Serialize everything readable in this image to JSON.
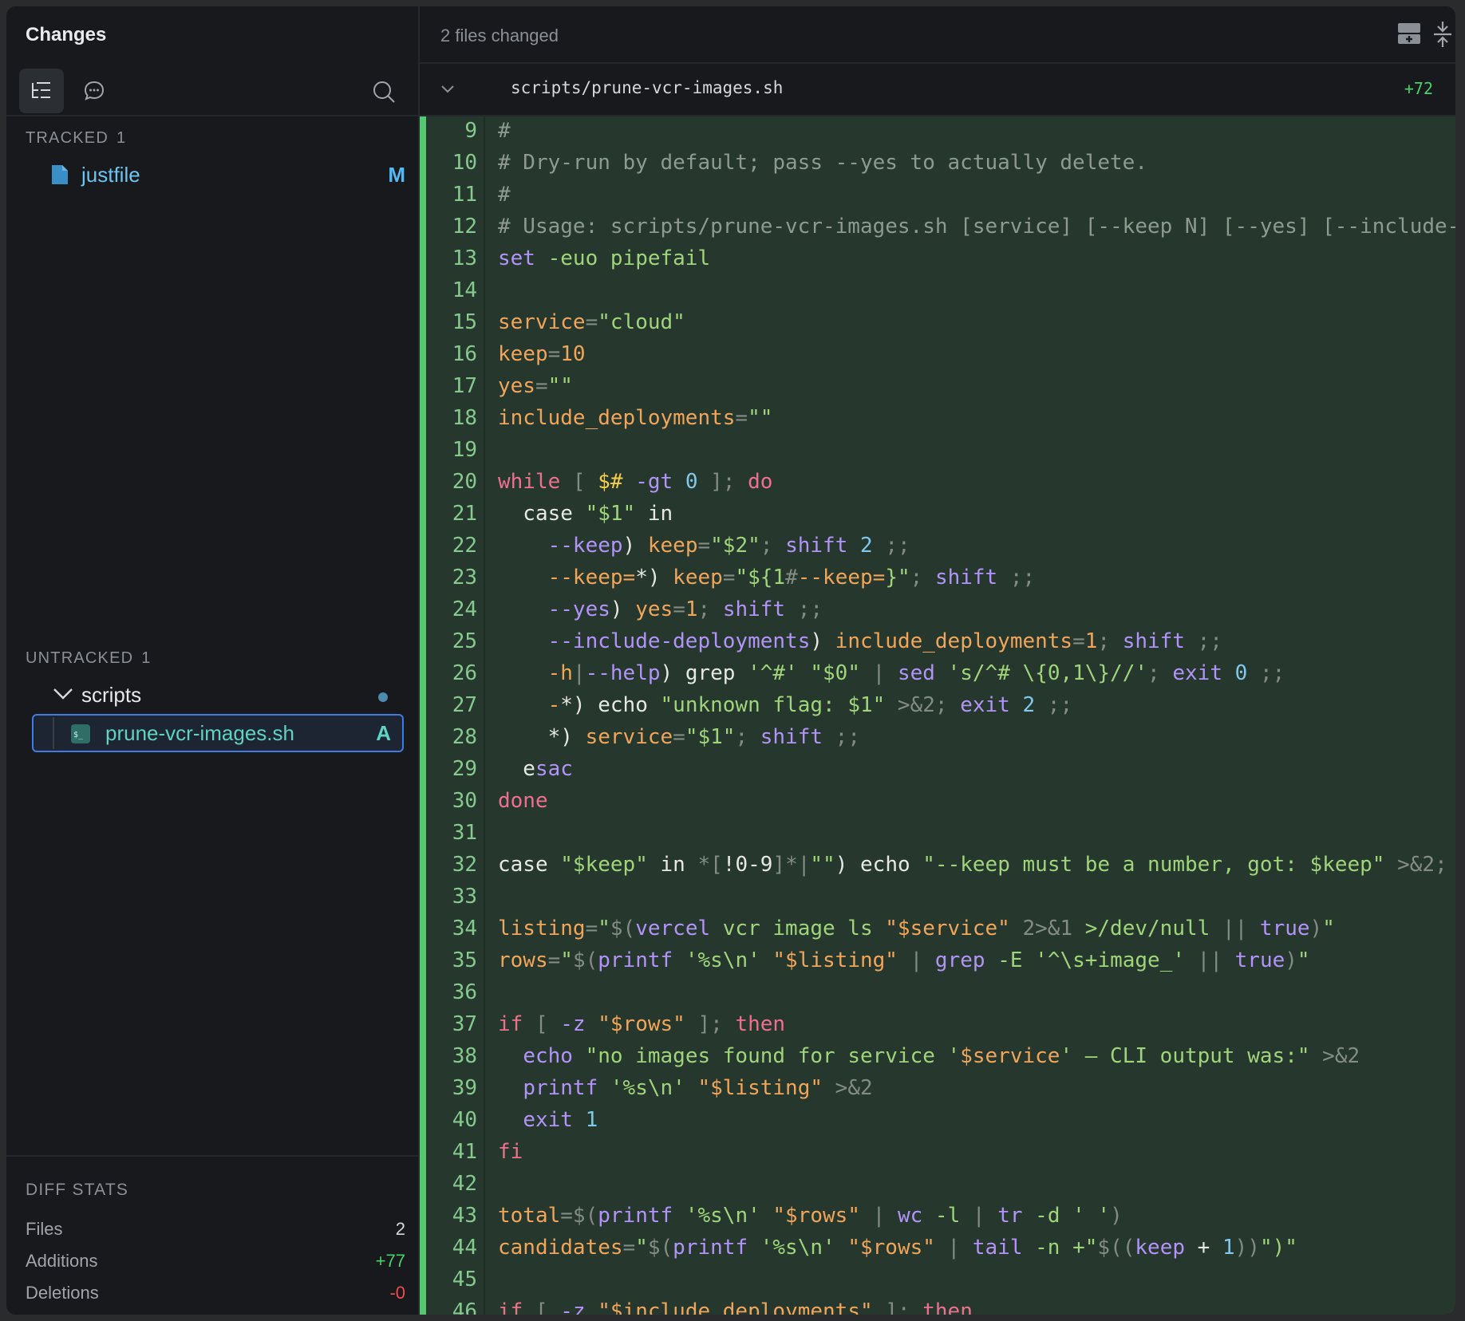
{
  "sidebar": {
    "title": "Changes",
    "tracked": {
      "label": "TRACKED",
      "count": "1",
      "file": "justfile",
      "status": "M"
    },
    "untracked": {
      "label": "UNTRACKED",
      "count": "1",
      "folder": "scripts",
      "file": "prune-vcr-images.sh",
      "status": "A"
    },
    "stats": {
      "label": "DIFF STATS",
      "files_label": "Files",
      "files_value": "2",
      "additions_label": "Additions",
      "additions_value": "+77",
      "deletions_label": "Deletions",
      "deletions_value": "-0"
    }
  },
  "header": {
    "files_changed": "2 files changed"
  },
  "file": {
    "path": "scripts/prune-vcr-images.sh",
    "additions": "+72"
  },
  "colors": {
    "accent": "#3f7be0",
    "added": "#56c86f",
    "code_bg": "#26382d"
  },
  "code_lines": [
    {
      "n": "9",
      "tokens": [
        [
          "cm",
          "#"
        ]
      ]
    },
    {
      "n": "10",
      "tokens": [
        [
          "cm",
          "# Dry-run by default; pass --yes to actually delete."
        ]
      ]
    },
    {
      "n": "11",
      "tokens": [
        [
          "cm",
          "#"
        ]
      ]
    },
    {
      "n": "12",
      "tokens": [
        [
          "cm",
          "# Usage: scripts/prune-vcr-images.sh [service] [--keep N] [--yes] [--include-"
        ]
      ]
    },
    {
      "n": "13",
      "tokens": [
        [
          "bi",
          "set"
        ],
        [
          "pl",
          " "
        ],
        [
          "st",
          "-euo pipefail"
        ]
      ]
    },
    {
      "n": "14",
      "tokens": []
    },
    {
      "n": "15",
      "tokens": [
        [
          "va",
          "service"
        ],
        [
          "op",
          "="
        ],
        [
          "st",
          "\"cloud\""
        ]
      ]
    },
    {
      "n": "16",
      "tokens": [
        [
          "va",
          "keep"
        ],
        [
          "op",
          "="
        ],
        [
          "va",
          "10"
        ]
      ]
    },
    {
      "n": "17",
      "tokens": [
        [
          "va",
          "yes"
        ],
        [
          "op",
          "="
        ],
        [
          "st",
          "\"\""
        ]
      ]
    },
    {
      "n": "18",
      "tokens": [
        [
          "va",
          "include_deployments"
        ],
        [
          "op",
          "="
        ],
        [
          "st",
          "\"\""
        ]
      ]
    },
    {
      "n": "19",
      "tokens": []
    },
    {
      "n": "20",
      "tokens": [
        [
          "kw",
          "while"
        ],
        [
          "op",
          " [ "
        ],
        [
          "sy",
          "$#"
        ],
        [
          "bi",
          " -gt "
        ],
        [
          "nu",
          "0"
        ],
        [
          "op",
          " ]; "
        ],
        [
          "kw",
          "do"
        ]
      ]
    },
    {
      "n": "21",
      "tokens": [
        [
          "pl",
          "  case "
        ],
        [
          "st",
          "\"$1\""
        ],
        [
          "pl",
          " in"
        ]
      ]
    },
    {
      "n": "22",
      "tokens": [
        [
          "pl",
          "    "
        ],
        [
          "bi",
          "--keep"
        ],
        [
          "pl",
          ") "
        ],
        [
          "va",
          "keep"
        ],
        [
          "op",
          "="
        ],
        [
          "st",
          "\"$2\""
        ],
        [
          "op",
          "; "
        ],
        [
          "bi",
          "shift"
        ],
        [
          "pl",
          " "
        ],
        [
          "nu",
          "2"
        ],
        [
          "op",
          " ;;"
        ]
      ]
    },
    {
      "n": "23",
      "tokens": [
        [
          "pl",
          "    "
        ],
        [
          "va",
          "--keep="
        ],
        [
          "pl",
          "*) "
        ],
        [
          "va",
          "keep"
        ],
        [
          "op",
          "="
        ],
        [
          "st",
          "\"${1"
        ],
        [
          "op",
          "#"
        ],
        [
          "va",
          "--keep="
        ],
        [
          "st",
          "}\""
        ],
        [
          "op",
          "; "
        ],
        [
          "bi",
          "shift"
        ],
        [
          "op",
          " ;;"
        ]
      ]
    },
    {
      "n": "24",
      "tokens": [
        [
          "pl",
          "    "
        ],
        [
          "bi",
          "--yes"
        ],
        [
          "pl",
          ") "
        ],
        [
          "va",
          "yes"
        ],
        [
          "op",
          "="
        ],
        [
          "va",
          "1"
        ],
        [
          "op",
          "; "
        ],
        [
          "bi",
          "shift"
        ],
        [
          "op",
          " ;;"
        ]
      ]
    },
    {
      "n": "25",
      "tokens": [
        [
          "pl",
          "    "
        ],
        [
          "bi",
          "--include-deployments"
        ],
        [
          "pl",
          ") "
        ],
        [
          "va",
          "include_deployments"
        ],
        [
          "op",
          "="
        ],
        [
          "va",
          "1"
        ],
        [
          "op",
          "; "
        ],
        [
          "bi",
          "shift"
        ],
        [
          "op",
          " ;;"
        ]
      ]
    },
    {
      "n": "26",
      "tokens": [
        [
          "pl",
          "    "
        ],
        [
          "va",
          "-h"
        ],
        [
          "op",
          "|"
        ],
        [
          "bi",
          "--help"
        ],
        [
          "pl",
          ") grep "
        ],
        [
          "st",
          "'^#'"
        ],
        [
          "pl",
          " "
        ],
        [
          "st",
          "\"$0\""
        ],
        [
          "op",
          " | "
        ],
        [
          "bi",
          "sed"
        ],
        [
          "pl",
          " "
        ],
        [
          "st",
          "'s/^# \\{0,1\\}//'"
        ],
        [
          "op",
          "; "
        ],
        [
          "bi",
          "exit"
        ],
        [
          "pl",
          " "
        ],
        [
          "nu",
          "0"
        ],
        [
          "op",
          " ;;"
        ]
      ]
    },
    {
      "n": "27",
      "tokens": [
        [
          "pl",
          "    "
        ],
        [
          "va",
          "-"
        ],
        [
          "pl",
          "*) echo "
        ],
        [
          "st",
          "\"unknown flag: $1\""
        ],
        [
          "op",
          " >&2; "
        ],
        [
          "bi",
          "exit"
        ],
        [
          "pl",
          " "
        ],
        [
          "nu",
          "2"
        ],
        [
          "op",
          " ;;"
        ]
      ]
    },
    {
      "n": "28",
      "tokens": [
        [
          "pl",
          "    *) "
        ],
        [
          "va",
          "service"
        ],
        [
          "op",
          "="
        ],
        [
          "st",
          "\"$1\""
        ],
        [
          "op",
          "; "
        ],
        [
          "bi",
          "shift"
        ],
        [
          "op",
          " ;;"
        ]
      ]
    },
    {
      "n": "29",
      "tokens": [
        [
          "pl",
          "  e"
        ],
        [
          "bi",
          "sac"
        ]
      ]
    },
    {
      "n": "30",
      "tokens": [
        [
          "kw",
          "done"
        ]
      ]
    },
    {
      "n": "31",
      "tokens": []
    },
    {
      "n": "32",
      "tokens": [
        [
          "pl",
          "case "
        ],
        [
          "st",
          "\"$keep\""
        ],
        [
          "pl",
          " in "
        ],
        [
          "op",
          "*["
        ],
        [
          "pl",
          "!0-9"
        ],
        [
          "op",
          "]*|"
        ],
        [
          "st",
          "\"\""
        ],
        [
          "pl",
          ") echo "
        ],
        [
          "st",
          "\"--keep must be a number, got: $keep\""
        ],
        [
          "op",
          " >&2;"
        ]
      ]
    },
    {
      "n": "33",
      "tokens": []
    },
    {
      "n": "34",
      "tokens": [
        [
          "va",
          "listing"
        ],
        [
          "op",
          "="
        ],
        [
          "st",
          "\""
        ],
        [
          "op",
          "$("
        ],
        [
          "bi",
          "vercel"
        ],
        [
          "st",
          " vcr image ls "
        ],
        [
          "va",
          "\"$service\""
        ],
        [
          "op",
          " 2>&1 "
        ],
        [
          "st",
          ">/dev/null"
        ],
        [
          "op",
          " || "
        ],
        [
          "bi",
          "true"
        ],
        [
          "op",
          ")"
        ],
        [
          "st",
          "\""
        ]
      ]
    },
    {
      "n": "35",
      "tokens": [
        [
          "va",
          "rows"
        ],
        [
          "op",
          "="
        ],
        [
          "st",
          "\""
        ],
        [
          "op",
          "$("
        ],
        [
          "bi",
          "printf"
        ],
        [
          "pl",
          " "
        ],
        [
          "st",
          "'%s\\n'"
        ],
        [
          "pl",
          " "
        ],
        [
          "va",
          "\"$listing\""
        ],
        [
          "op",
          " | "
        ],
        [
          "bi",
          "grep"
        ],
        [
          "st",
          " -E "
        ],
        [
          "st",
          "'^\\s+image_'"
        ],
        [
          "op",
          " || "
        ],
        [
          "bi",
          "true"
        ],
        [
          "op",
          ")"
        ],
        [
          "st",
          "\""
        ]
      ]
    },
    {
      "n": "36",
      "tokens": []
    },
    {
      "n": "37",
      "tokens": [
        [
          "kw",
          "if"
        ],
        [
          "op",
          " [ "
        ],
        [
          "bi",
          "-z"
        ],
        [
          "pl",
          " "
        ],
        [
          "va",
          "\"$rows\""
        ],
        [
          "op",
          " ]; "
        ],
        [
          "kw",
          "then"
        ]
      ]
    },
    {
      "n": "38",
      "tokens": [
        [
          "pl",
          "  "
        ],
        [
          "bi",
          "echo"
        ],
        [
          "pl",
          " "
        ],
        [
          "st",
          "\"no images found for service '"
        ],
        [
          "va",
          "$service"
        ],
        [
          "st",
          "' — CLI output was:\""
        ],
        [
          "op",
          " >&2"
        ]
      ]
    },
    {
      "n": "39",
      "tokens": [
        [
          "pl",
          "  "
        ],
        [
          "bi",
          "printf"
        ],
        [
          "pl",
          " "
        ],
        [
          "st",
          "'%s\\n'"
        ],
        [
          "pl",
          " "
        ],
        [
          "va",
          "\"$listing\""
        ],
        [
          "op",
          " >&2"
        ]
      ]
    },
    {
      "n": "40",
      "tokens": [
        [
          "pl",
          "  "
        ],
        [
          "bi",
          "exit"
        ],
        [
          "pl",
          " "
        ],
        [
          "nu",
          "1"
        ]
      ]
    },
    {
      "n": "41",
      "tokens": [
        [
          "kw",
          "fi"
        ]
      ]
    },
    {
      "n": "42",
      "tokens": []
    },
    {
      "n": "43",
      "tokens": [
        [
          "va",
          "total"
        ],
        [
          "op",
          "=$("
        ],
        [
          "bi",
          "printf"
        ],
        [
          "pl",
          " "
        ],
        [
          "st",
          "'%s\\n'"
        ],
        [
          "pl",
          " "
        ],
        [
          "va",
          "\"$rows\""
        ],
        [
          "op",
          " | "
        ],
        [
          "bi",
          "wc"
        ],
        [
          "st",
          " -l"
        ],
        [
          "op",
          " | "
        ],
        [
          "bi",
          "tr"
        ],
        [
          "st",
          " -d ' '"
        ],
        [
          "op",
          ")"
        ]
      ]
    },
    {
      "n": "44",
      "tokens": [
        [
          "va",
          "candidates"
        ],
        [
          "op",
          "="
        ],
        [
          "st",
          "\""
        ],
        [
          "op",
          "$("
        ],
        [
          "bi",
          "printf"
        ],
        [
          "pl",
          " "
        ],
        [
          "st",
          "'%s\\n'"
        ],
        [
          "pl",
          " "
        ],
        [
          "va",
          "\"$rows\""
        ],
        [
          "op",
          " | "
        ],
        [
          "bi",
          "tail"
        ],
        [
          "st",
          " -n +\""
        ],
        [
          "op",
          "$(("
        ],
        [
          "bi",
          "keep"
        ],
        [
          "pl",
          " + "
        ],
        [
          "nu",
          "1"
        ],
        [
          "op",
          "))"
        ],
        [
          "st",
          "\")\""
        ]
      ]
    },
    {
      "n": "45",
      "tokens": []
    },
    {
      "n": "46",
      "tokens": [
        [
          "kw",
          "if"
        ],
        [
          "op",
          " [ "
        ],
        [
          "bi",
          "-z"
        ],
        [
          "pl",
          " "
        ],
        [
          "va",
          "\"$include_deployments\""
        ],
        [
          "op",
          " ]; "
        ],
        [
          "kw",
          "then"
        ]
      ]
    }
  ]
}
